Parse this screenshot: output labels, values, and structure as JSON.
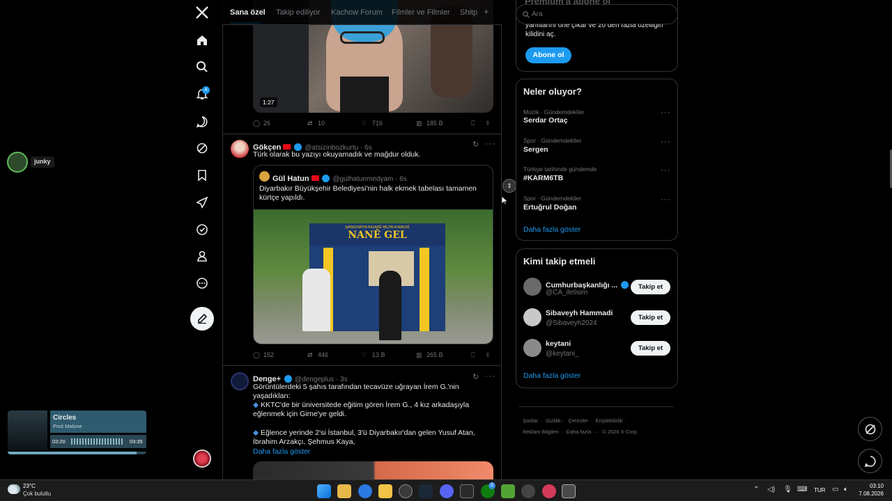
{
  "tabs": [
    "Sana özel",
    "Takip ediliyor",
    "Kachow Forum",
    "Filmler ve Filmler",
    "Shitp"
  ],
  "tabs_plus": "+",
  "post0": {
    "duration": "1:27",
    "replies": "26",
    "retweets": "10",
    "likes": "716",
    "views": "185 B"
  },
  "post1": {
    "name": "Gökçen",
    "handle": "@atsizinbozkurtu · 6s",
    "text": "Türk olarak bu yazıyı okuyamadık ve mağdur olduk.",
    "quote": {
      "name": "Gül Hatun",
      "handle": "@gulhatunmedyam · 6s",
      "text": "Diyarbakır Büyükşehir Belediyesi'nin halk ekmek tabelası tamamen kürtçe yapıldı.",
      "sign_top": "ŞAREDARIYA BAJARÊ MEZIN A AMEDÊ",
      "sign_main": "NANÊ GEL"
    },
    "replies": "152",
    "retweets": "446",
    "likes": "13 B",
    "views": "265 B"
  },
  "post2": {
    "name": "Denge+",
    "handle": "@dengeplus · 3s",
    "text": "Görüntülerdeki 5 şahıs tarafından tecavüze uğrayan İrem G.'nin yaşadıkları:",
    "bullet1": "KKTC'de bir üniversitede eğitim gören İrem G., 4 kız arkadaşıyla eğlenmek için Girne'ye geldi.",
    "bullet2": "Eğlence yerinde 2'si İstanbul, 3'ü Diyarbakır'dan gelen Yusuf Atan, İbrahim Arzakçı, Şehmus Kaya,",
    "more": "Daha fazla göster"
  },
  "search": {
    "placeholder": "Ara"
  },
  "premium": {
    "partial_title": "Premium'a abone ol",
    "partial_text": "yanıtlarını öne çıkar ve 20 den fazla özelliğin",
    "partial_text2": "kilidini aç.",
    "button": "Abone ol"
  },
  "trends": {
    "title": "Neler oluyor?",
    "items": [
      {
        "meta": "Müzik · Gündemdekiler",
        "topic": "Serdar Ortaç"
      },
      {
        "meta": "Spor · Gündemdekiler",
        "topic": "Sergen"
      },
      {
        "meta": "Türkiye tarihinde gündemde",
        "topic": "#KARM6TB"
      },
      {
        "meta": "Spor · Gündemdekiler",
        "topic": "Ertuğrul Doğan"
      }
    ],
    "more": "Daha fazla göster"
  },
  "who": {
    "title": "Kimi takip etmeli",
    "items": [
      {
        "name": "Cumhurbaşkanlığı ...",
        "handle": "@CA_iletisim",
        "button": "Takip et"
      },
      {
        "name": "Sibaveyh Hammadi",
        "handle": "@Sibaveyh2024",
        "button": "Takip et"
      },
      {
        "name": "keytani",
        "handle": "@keytani_",
        "button": "Takip et"
      }
    ],
    "more": "Daha fazla göster"
  },
  "footer": {
    "l1": [
      "Şartlar",
      "Gizlilik",
      "Çerezler",
      "Erişilebilirlik"
    ],
    "l2a": "Reklam Bilgileri",
    "l2b": "Daha fazla ···",
    "l2c": "© 2026 X Corp."
  },
  "overlay": {
    "user": "junky"
  },
  "music": {
    "title": "Circles",
    "artist": "Post Malone",
    "elapsed": "03:20",
    "total": "03:35",
    "progress": 0.93
  },
  "taskbar": {
    "temp": "23°C",
    "weather": "Çok bulutlu",
    "lang": "TUR",
    "time": "03:10",
    "date": "7.08.2026",
    "badge": "2"
  },
  "colors": {
    "accent": "#1d9bf0",
    "bg": "#000000",
    "border": "#2f3336"
  }
}
